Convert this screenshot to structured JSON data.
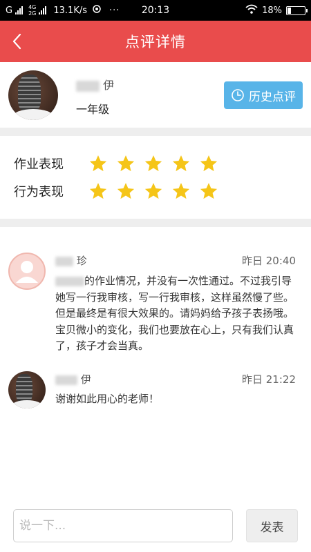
{
  "status_bar": {
    "carrier": "G",
    "network": "4G",
    "network2": "2G",
    "speed": "13.1K/s",
    "dots": "···",
    "time": "20:13",
    "battery": "18%",
    "battery_level": 0.18
  },
  "header": {
    "title": "点评详情"
  },
  "profile": {
    "name_visible": "伊",
    "grade": "一年级",
    "history_button": "历史点评"
  },
  "ratings": [
    {
      "label": "作业表现",
      "stars": 5,
      "max": 5
    },
    {
      "label": "行为表现",
      "stars": 5,
      "max": 5
    }
  ],
  "colors": {
    "header": "#e94c4c",
    "history_button": "#58b4e8",
    "star": "#f5c518"
  },
  "comments": [
    {
      "name_visible": "珍",
      "time": "昨日 20:40",
      "text": "的作业情况，并没有一次性通过。不过我引导她写一行我审核，写一行我审核，这样虽然慢了些。但是最终是有很大效果的。请妈妈给予孩子表扬哦。宝贝微小的变化，我们也要放在心上，只有我们认真了，孩子才会当真。"
    },
    {
      "name_visible": "伊",
      "time": "昨日 21:22",
      "text": "谢谢如此用心的老师！"
    }
  ],
  "input": {
    "placeholder": "说一下...",
    "value": ""
  },
  "send_button": "发表"
}
